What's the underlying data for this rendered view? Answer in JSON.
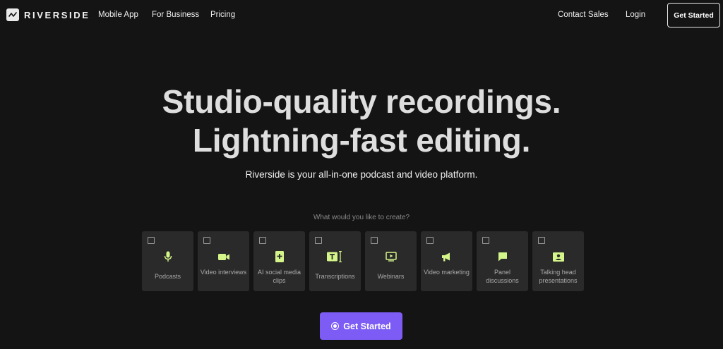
{
  "nav": {
    "brand": "RIVERSIDE",
    "links": [
      {
        "label": "Mobile App"
      },
      {
        "label": "For Business"
      },
      {
        "label": "Pricing"
      }
    ],
    "right_links": [
      {
        "label": "Contact Sales"
      },
      {
        "label": "Login"
      }
    ],
    "cta_label": "Get Started"
  },
  "hero": {
    "title_line1": "Studio-quality recordings.",
    "title_line2": "Lightning-fast editing.",
    "subtitle": "Riverside is your all-in-one podcast and video platform.",
    "prompt": "What would you like to create?"
  },
  "options": [
    {
      "label": "Podcasts",
      "icon": "microphone-icon",
      "checked": false
    },
    {
      "label": "Video interviews",
      "icon": "video-camera-icon",
      "checked": false
    },
    {
      "label": "AI social media clips",
      "icon": "ai-clip-icon",
      "checked": false
    },
    {
      "label": "Transcriptions",
      "icon": "text-transcription-icon",
      "checked": false
    },
    {
      "label": "Webinars",
      "icon": "webinar-screen-icon",
      "checked": false
    },
    {
      "label": "Video marketing",
      "icon": "megaphone-icon",
      "checked": false
    },
    {
      "label": "Panel discussions",
      "icon": "chat-bubble-icon",
      "checked": false
    },
    {
      "label": "Talking head presentations",
      "icon": "presenter-icon",
      "checked": false
    }
  ],
  "cta": {
    "label": "Get Started",
    "icon": "record-icon"
  },
  "colors": {
    "background": "#141414",
    "accent": "#7c5cf5",
    "icon_green": "#d4f58a",
    "card": "#2a2a2a"
  }
}
